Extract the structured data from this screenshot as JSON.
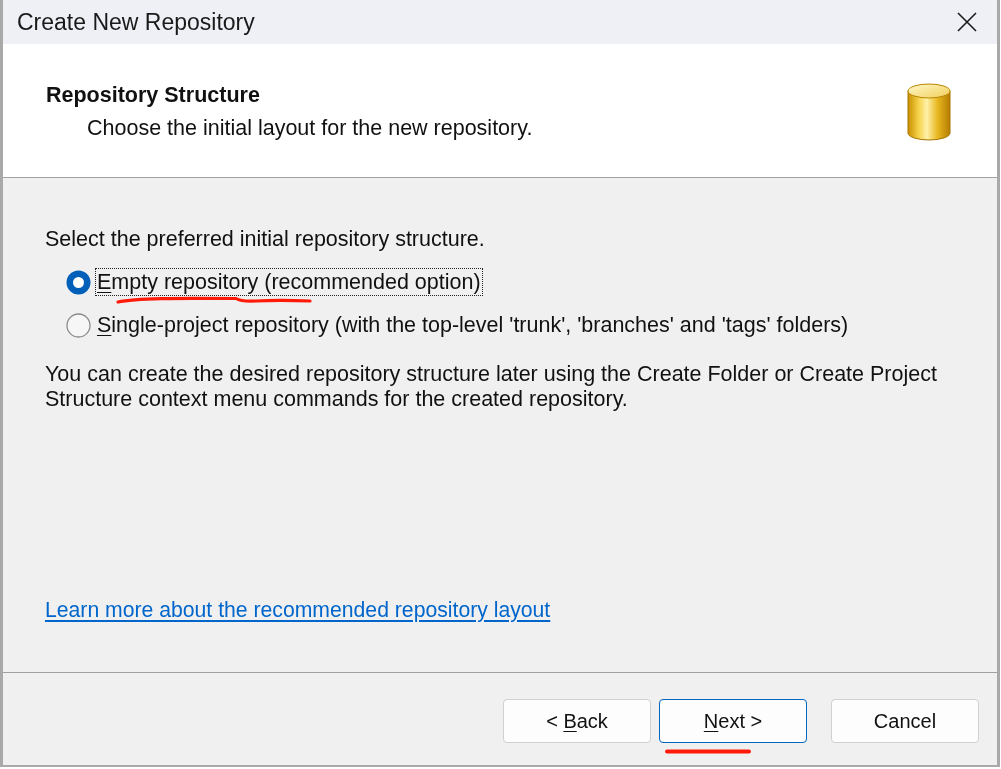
{
  "window": {
    "title": "Create New Repository"
  },
  "header": {
    "title": "Repository Structure",
    "subtitle": "Choose the initial layout for the new repository."
  },
  "body": {
    "prompt": "Select the preferred initial repository structure.",
    "options": [
      {
        "label_parts": [
          {
            "text": "E",
            "access_key": true
          },
          {
            "text": "mpty repository (recommended option)",
            "access_key": false
          }
        ],
        "selected": true,
        "focused": true,
        "annotated": true
      },
      {
        "label_parts": [
          {
            "text": "S",
            "access_key": true
          },
          {
            "text": "ingle-project repository (with the top-level 'trunk', 'branches' and 'tags' folders)",
            "access_key": false
          }
        ],
        "selected": false,
        "focused": false,
        "annotated": false
      }
    ],
    "note": "You can create the desired repository structure later using the Create Folder or Create Project Structure context menu commands for the created repository.",
    "link": "Learn more about the recommended repository layout"
  },
  "buttons": [
    {
      "label_parts": [
        {
          "text": "< ",
          "access_key": false
        },
        {
          "text": "B",
          "access_key": true
        },
        {
          "text": "ack",
          "access_key": false
        }
      ],
      "default": false,
      "annotated": false
    },
    {
      "label_parts": [
        {
          "text": "N",
          "access_key": true
        },
        {
          "text": "ext >",
          "access_key": false
        }
      ],
      "default": true,
      "annotated": true
    },
    {
      "label_parts": [
        {
          "text": "Cancel",
          "access_key": false
        }
      ],
      "default": false,
      "annotated": false
    }
  ]
}
